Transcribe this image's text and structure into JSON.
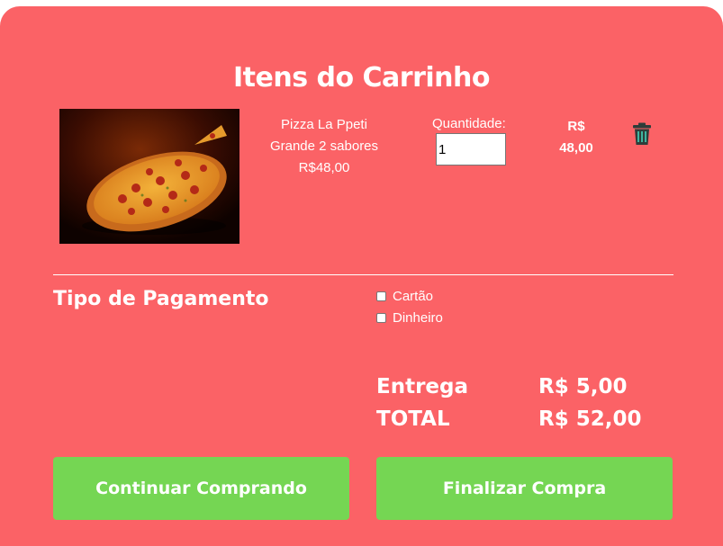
{
  "colors": {
    "card_bg": "#fb6266",
    "button_bg": "#75d653",
    "text": "#ffffff"
  },
  "cart": {
    "title": "Itens do Carrinho",
    "item": {
      "name_line1": "Pizza La Ppeti",
      "name_line2": "Grande 2 sabores",
      "unit_price": "R$48,00",
      "quantity_label": "Quantidade:",
      "quantity_value": "1",
      "price_line1": "R$",
      "price_line2": "48,00",
      "image_icon": "pizza-photo",
      "delete_icon": "trash-icon"
    }
  },
  "payment": {
    "title": "Tipo de Pagamento",
    "options": [
      {
        "label": "Cartão",
        "checked": false
      },
      {
        "label": "Dinheiro",
        "checked": false
      }
    ]
  },
  "summary": {
    "delivery_label": "Entrega",
    "delivery_value": "R$ 5,00",
    "total_label": "TOTAL",
    "total_value": "R$ 52,00"
  },
  "actions": {
    "continue_label": "Continuar Comprando",
    "finish_label": "Finalizar Compra"
  }
}
